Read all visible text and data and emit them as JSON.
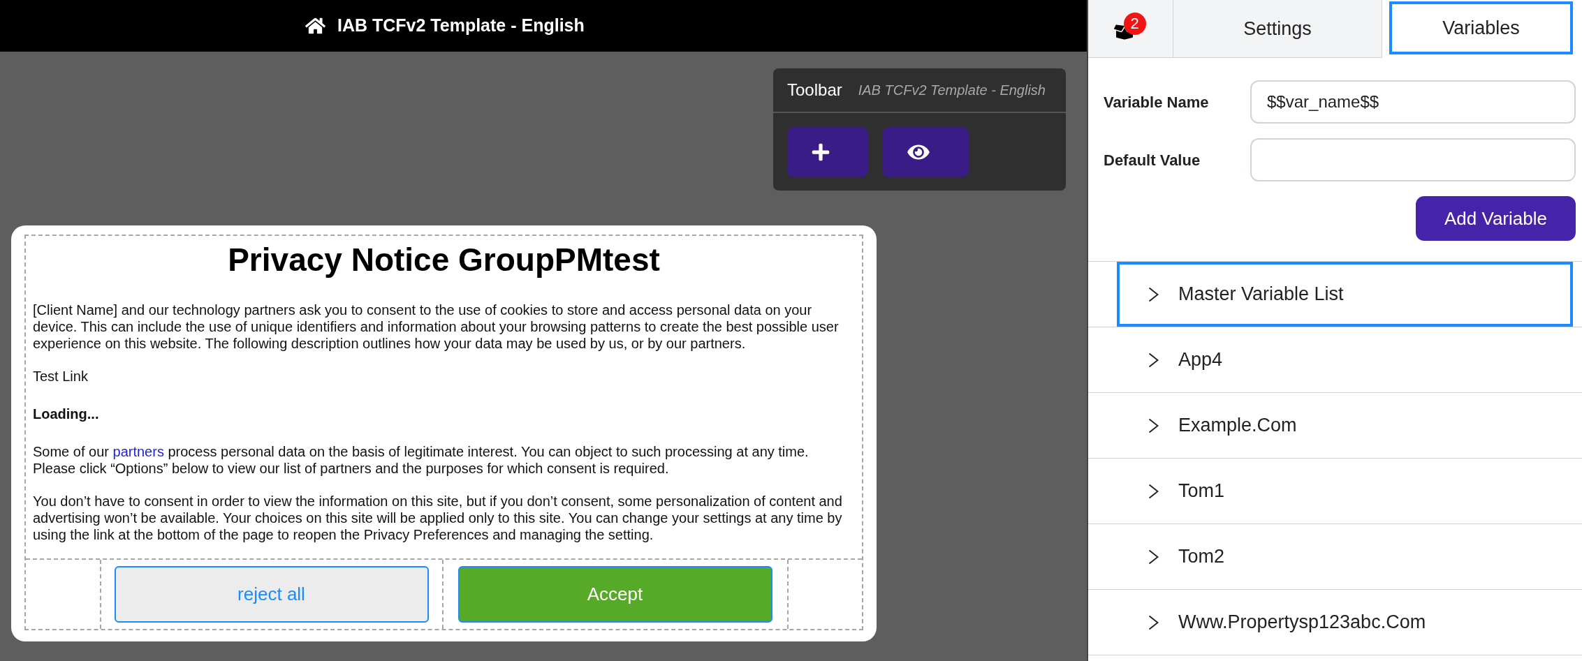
{
  "header": {
    "title": "IAB TCFv2 Template - English"
  },
  "toolbar": {
    "title": "Toolbar",
    "subtitle": "IAB TCFv2 Template - English",
    "buttons": [
      {
        "kind": "add"
      },
      {
        "kind": "preview"
      }
    ]
  },
  "notice": {
    "title": "Privacy Notice GroupPMtest",
    "paragraphs": [
      {
        "kind": "text",
        "text": "[Client Name] and our technology partners ask you to consent to the use of cookies to store and access personal data on your device. This can include the use of unique identifiers and information about your browsing patterns to create the best possible user experience on this website. The following description outlines how your data may be used by us, or by our partners."
      },
      {
        "kind": "text",
        "text": "Test Link"
      },
      {
        "kind": "bold",
        "text": "Loading..."
      },
      {
        "kind": "link_text",
        "before": "Some of our ",
        "link": "partners",
        "after": " process personal data on the basis of legitimate interest. You can object to such processing at any time. Please click “Options” below to view our list of partners and the purposes for which consent is required."
      },
      {
        "kind": "text",
        "text": "You don’t have to consent in order to view the information on this site, but if you don’t consent, some personalization of content and advertising won’t be available. Your choices on this site will be applied only to this site. You can change your settings at any time by using the link at the bottom of the page to reopen the Privacy Preferences and managing the setting."
      }
    ],
    "buttons": [
      {
        "kind": "reject",
        "label": "reject all"
      },
      {
        "kind": "accept",
        "label": "Accept"
      }
    ]
  },
  "panel": {
    "tabs": [
      {
        "kind": "icon",
        "badge": "2",
        "selected": false
      },
      {
        "kind": "text",
        "label": "Settings",
        "selected": false
      },
      {
        "kind": "text",
        "label": "Variables",
        "selected": true
      }
    ],
    "form": {
      "fields": [
        {
          "label": "Variable Name",
          "value": "$$var_name$$"
        },
        {
          "label": "Default Value"
        }
      ],
      "button": "Add Variable"
    },
    "variable_lists": [
      {
        "label": "Master Variable List",
        "focused": true,
        "expanded": false
      },
      {
        "label": "App4",
        "focused": false,
        "expanded": false
      },
      {
        "label": "Example.Com",
        "focused": false,
        "expanded": false
      },
      {
        "label": "Tom1",
        "focused": false,
        "expanded": false
      },
      {
        "label": "Tom2",
        "focused": false,
        "expanded": false
      },
      {
        "label": "Www.Propertysp123abc.Com",
        "focused": false,
        "expanded": false
      }
    ]
  }
}
